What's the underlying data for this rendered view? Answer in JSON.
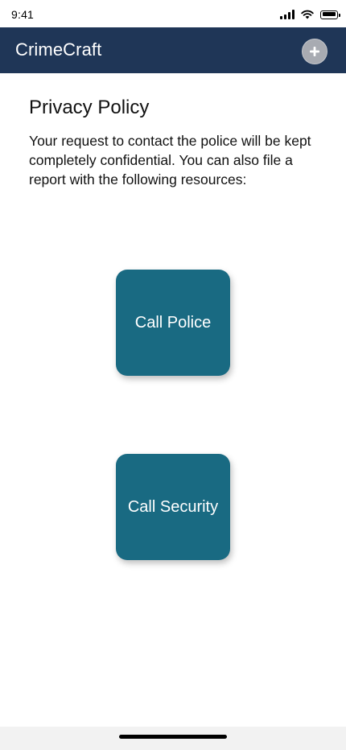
{
  "status_bar": {
    "time": "9:41",
    "icons": [
      "signal-icon",
      "wifi-icon",
      "battery-icon"
    ]
  },
  "header": {
    "title": "CrimeCraft",
    "add_icon": "plus-icon",
    "background": "#1f3657"
  },
  "content": {
    "title": "Privacy Policy",
    "body": "Your request to contact the police will be kept completely confidential. You can also file a report with the following resources:"
  },
  "actions": [
    {
      "label": "Call Police"
    },
    {
      "label": "Call Security"
    }
  ],
  "colors": {
    "tile": "#196a82",
    "accent_button": "#a8abb2"
  }
}
